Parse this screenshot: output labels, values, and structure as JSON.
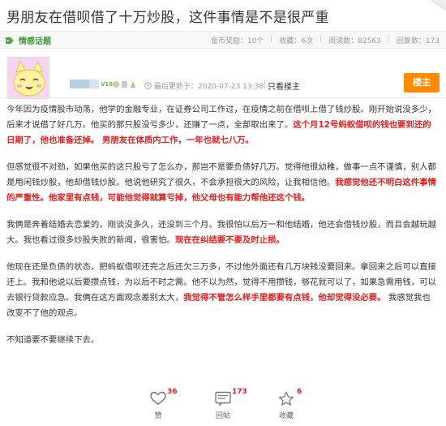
{
  "post": {
    "title": "男朋友在借呗借了十万炒股，这件事情是不是很严重"
  },
  "meta": {
    "tag": "情感话题",
    "stats": [
      "金币奖励：10个",
      "收藏：6次",
      "阅读数：82563",
      "回复数：173"
    ]
  },
  "author": {
    "level": "V16",
    "update_time": "最后更新于：2020-07-23 13:38",
    "only_op": "只看楼主",
    "op_badge": "楼主"
  },
  "content": {
    "p1": "今年因为疫情股市动荡，他学的金融专业，在证券公司工作过，在疫情之前在借呗上借了钱炒股。刚开始说没多少，后来才说借了好几万。他买的那只股没亏多少，还赚了一点，全部取出来了。",
    "p1_red": "这个月12号蚂蚁借呗的钱也要到还的日期了，他也准备还掉。 男朋友在体质内工作，一年也就七八万。",
    "p2": "但感觉很不对劲，如果他买的这只股亏了怎么办，那岂不是要负债好几万。觉得他很幼稚，做事一点不谨慎，别人都是用闲钱炒股，他却借钱炒股。他说他研究了很久，不会承担很大的风险，让我相信他。",
    "p2_red": "我感觉他还不明白这件事情的严重性。他家里有点钱，可能他觉得就算亏掉，他父母也有能力帮他还这个钱。",
    "p3": "我俩是奔着结婚去恋爱的，刚谈没多久，还没到三个月。我很怕以后万一和他结婚，他还会借钱炒股，而且会越玩越大。我也看过很多炒股失败的新闻，很害怕。",
    "p3_red": "现在在纠结要不要及时止损。",
    "p4": "他现在还是负债的状态，把蚂蚁借呗还完之后还欠三万多，不过他外面还有几万块钱没要回来。拿回来之后可以直接还上。我和他说以后要攒点钱，为以后不时之需。他不以为然，觉得不用攒钱，够花就可以了，如果急需用钱，可以去银行贷款应急。我俩在这方面观念差别太大，",
    "p4_red": "我觉得不管怎么样手里都要有点钱，他却觉得没必要。",
    "p4_tail": " 我感觉我也改变不了他的观点。",
    "p5": "不知道要不要继续下去。"
  },
  "actions": {
    "like": {
      "label": "赞",
      "count": "36"
    },
    "reply": {
      "label": "回帖",
      "count": "173"
    },
    "collect": {
      "label": "收藏",
      "count": "6"
    }
  }
}
